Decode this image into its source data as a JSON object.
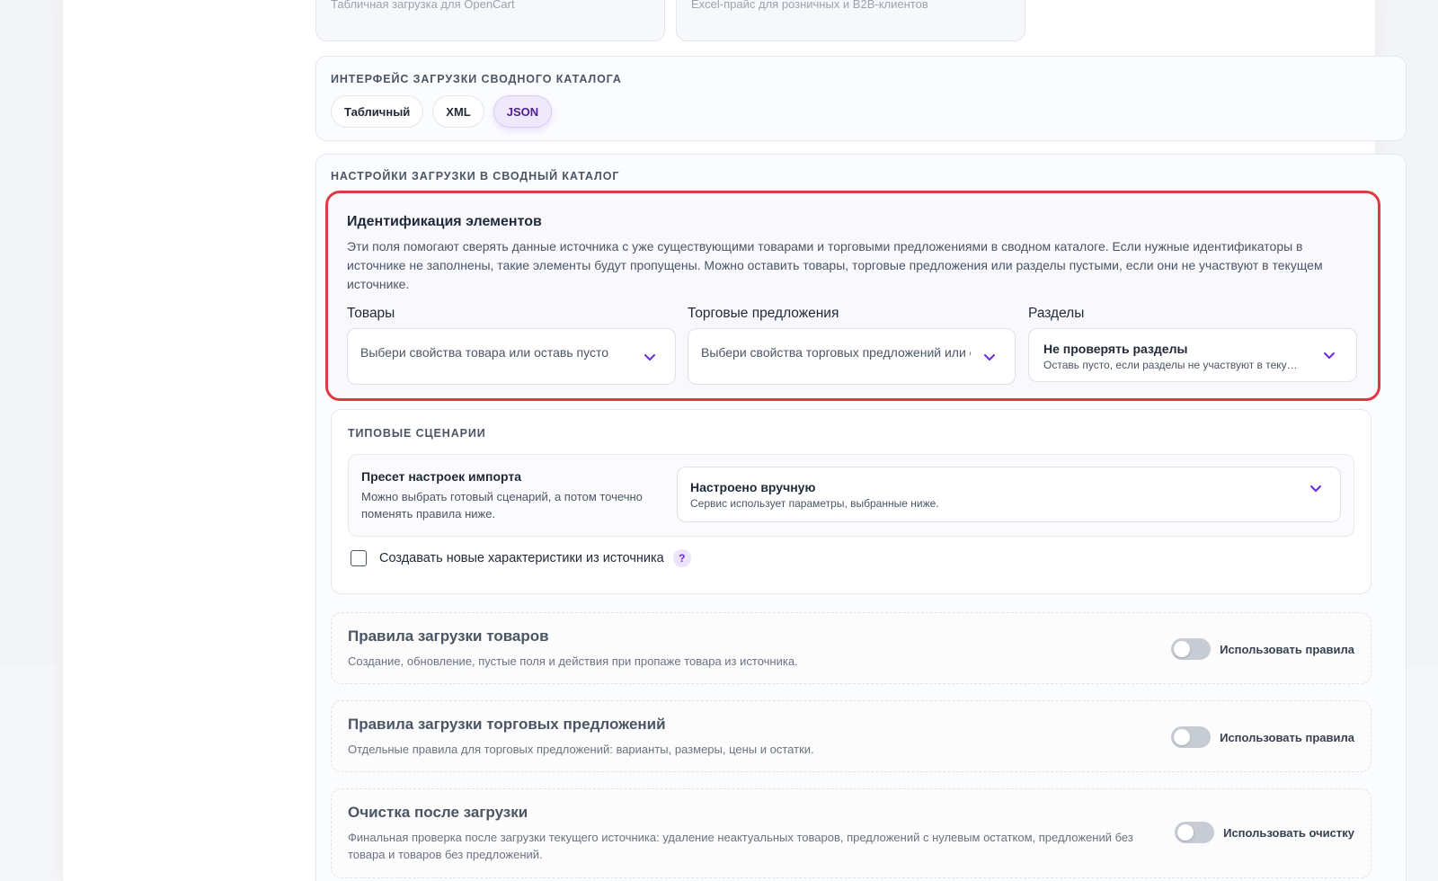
{
  "top_cards": [
    {
      "text": "Табличная загрузка для OpenCart"
    },
    {
      "text": "Excel-прайс для розничных и B2B-клиентов"
    }
  ],
  "interface_section": {
    "title": "ИНТЕРФЕЙС ЗАГРУЗКИ СВОДНОГО КАТАЛОГА",
    "options": [
      {
        "label": "Табличный"
      },
      {
        "label": "XML"
      },
      {
        "label": "JSON"
      }
    ],
    "selected": "JSON"
  },
  "settings_section": {
    "title": "НАСТРОЙКИ ЗАГРУЗКИ В СВОДНЫЙ КАТАЛОГ",
    "identification": {
      "title": "Идентификация элементов",
      "description": "Эти поля помогают сверять данные источника с уже существующими товарами и торговыми предложениями в сводном каталоге. Если нужные идентификаторы в источнике не заполнены, такие элементы будут пропущены. Можно оставить товары, торговые предложения или разделы пустыми, если они не участвуют в текущем источнике.",
      "products": {
        "label": "Товары",
        "placeholder": "Выбери свойства товара или оставь пусто"
      },
      "offers": {
        "label": "Торговые предложения",
        "placeholder": "Выбери свойства торговых предложений или оставь пусто"
      },
      "sections": {
        "label": "Разделы",
        "value": "Не проверять разделы",
        "hint": "Оставь пусто, если разделы не участвуют в текущем источнике"
      }
    },
    "typical": {
      "title": "ТИПОВЫЕ СЦЕНАРИИ",
      "preset_title": "Пресет настроек импорта",
      "preset_desc": "Можно выбрать готовый сценарий, а потом точечно поменять правила ниже.",
      "preset_value": "Настроено вручную",
      "preset_hint": "Сервис использует параметры, выбранные ниже.",
      "checkbox_label": "Создавать новые характеристики из источника",
      "help": "?"
    },
    "rules": [
      {
        "title": "Правила загрузки товаров",
        "desc": "Создание, обновление, пустые поля и действия при пропаже товара из источника.",
        "toggle_label": "Использовать правила"
      },
      {
        "title": "Правила загрузки торговых предложений",
        "desc": "Отдельные правила для торговых предложений: варианты, размеры, цены и остатки.",
        "toggle_label": "Использовать правила"
      },
      {
        "title": "Очистка после загрузки",
        "desc": "Финальная проверка после загрузки текущего источника: удаление неактуальных товаров, предложений с нулевым остатком, предложений без товара и товаров без предложений.",
        "toggle_label": "Использовать очистку"
      }
    ]
  },
  "colors": {
    "accent": "#6d28d9",
    "highlight_border": "#dc3b44"
  },
  "icons": {
    "chevron": "chevron-down-icon",
    "help": "help-icon"
  }
}
